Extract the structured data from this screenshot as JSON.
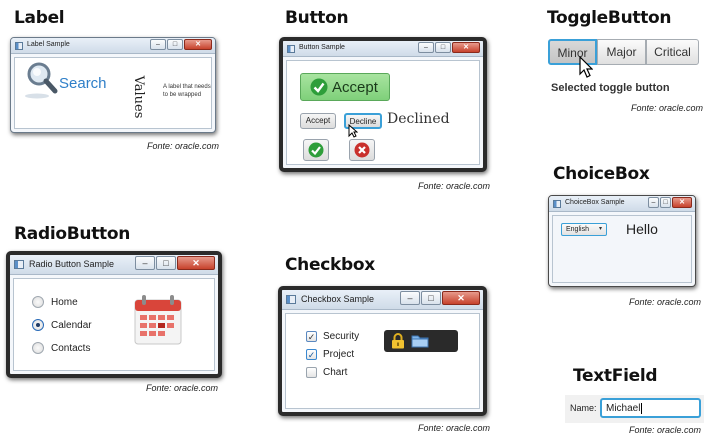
{
  "source_note": "Fonte: oracle.com",
  "label_section": {
    "heading": "Label",
    "window_title": "Label Sample",
    "search_text": "Search",
    "values_text": "Values",
    "wrapped_text": "A label that needs to be wrapped"
  },
  "button_section": {
    "heading": "Button",
    "window_title": "Button Sample",
    "accept_big": "Accept",
    "accept_small": "Accept",
    "decline": "Decline",
    "status": "Declined"
  },
  "toggle_section": {
    "heading": "ToggleButton",
    "buttons": [
      "Minor",
      "Major",
      "Critical"
    ],
    "selected_text": "Selected toggle button"
  },
  "choicebox_section": {
    "heading": "ChoiceBox",
    "window_title": "ChoiceBox Sample",
    "selected": "English",
    "greeting": "Hello"
  },
  "radio_section": {
    "heading": "RadioButton",
    "window_title": "Radio Button Sample",
    "options": [
      "Home",
      "Calendar",
      "Contacts"
    ],
    "selected": "Calendar"
  },
  "checkbox_section": {
    "heading": "Checkbox",
    "window_title": "Checkbox Sample",
    "items": [
      {
        "label": "Security",
        "checked": true
      },
      {
        "label": "Project",
        "checked": true
      },
      {
        "label": "Chart",
        "checked": false
      }
    ]
  },
  "textfield_section": {
    "heading": "TextField",
    "label": "Name:",
    "value": "Michael"
  },
  "icons": [
    "magnifier-icon",
    "check-icon",
    "cross-icon",
    "calendar-icon",
    "lock-icon",
    "folder-icon",
    "cursor-icon"
  ],
  "colors": {
    "accent_blue": "#2f7fc8",
    "accept_green": "#7fd07a",
    "close_red": "#c7422c"
  }
}
